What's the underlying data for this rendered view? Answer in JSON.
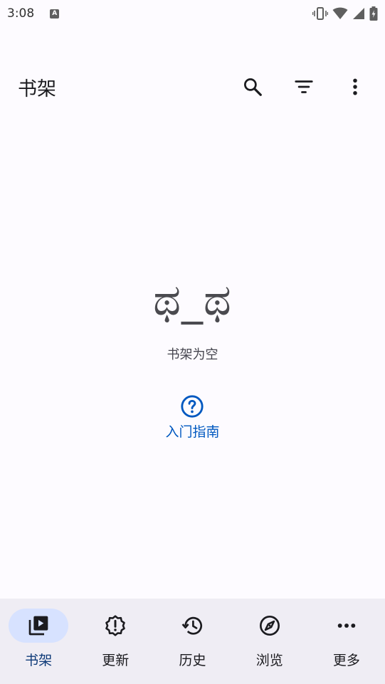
{
  "status_bar": {
    "time": "3:08",
    "notification_icon": "a-icon"
  },
  "app_bar": {
    "title": "书架",
    "actions": [
      "search-icon",
      "filter-icon",
      "more-vert-icon"
    ]
  },
  "empty_state": {
    "face": "ಥ_ಥ",
    "message": "书架为空",
    "guide_label": "入门指南"
  },
  "bottom_nav": {
    "items": [
      {
        "label": "书架",
        "icon": "library-icon",
        "active": true
      },
      {
        "label": "更新",
        "icon": "updates-icon",
        "active": false
      },
      {
        "label": "历史",
        "icon": "history-icon",
        "active": false
      },
      {
        "label": "浏览",
        "icon": "explore-icon",
        "active": false
      },
      {
        "label": "更多",
        "icon": "more-horiz-icon",
        "active": false
      }
    ]
  },
  "colors": {
    "background": "#fdfbff",
    "accent": "#0058c0",
    "nav_background": "#efedf4",
    "nav_active_pill": "#d7e2ff"
  }
}
